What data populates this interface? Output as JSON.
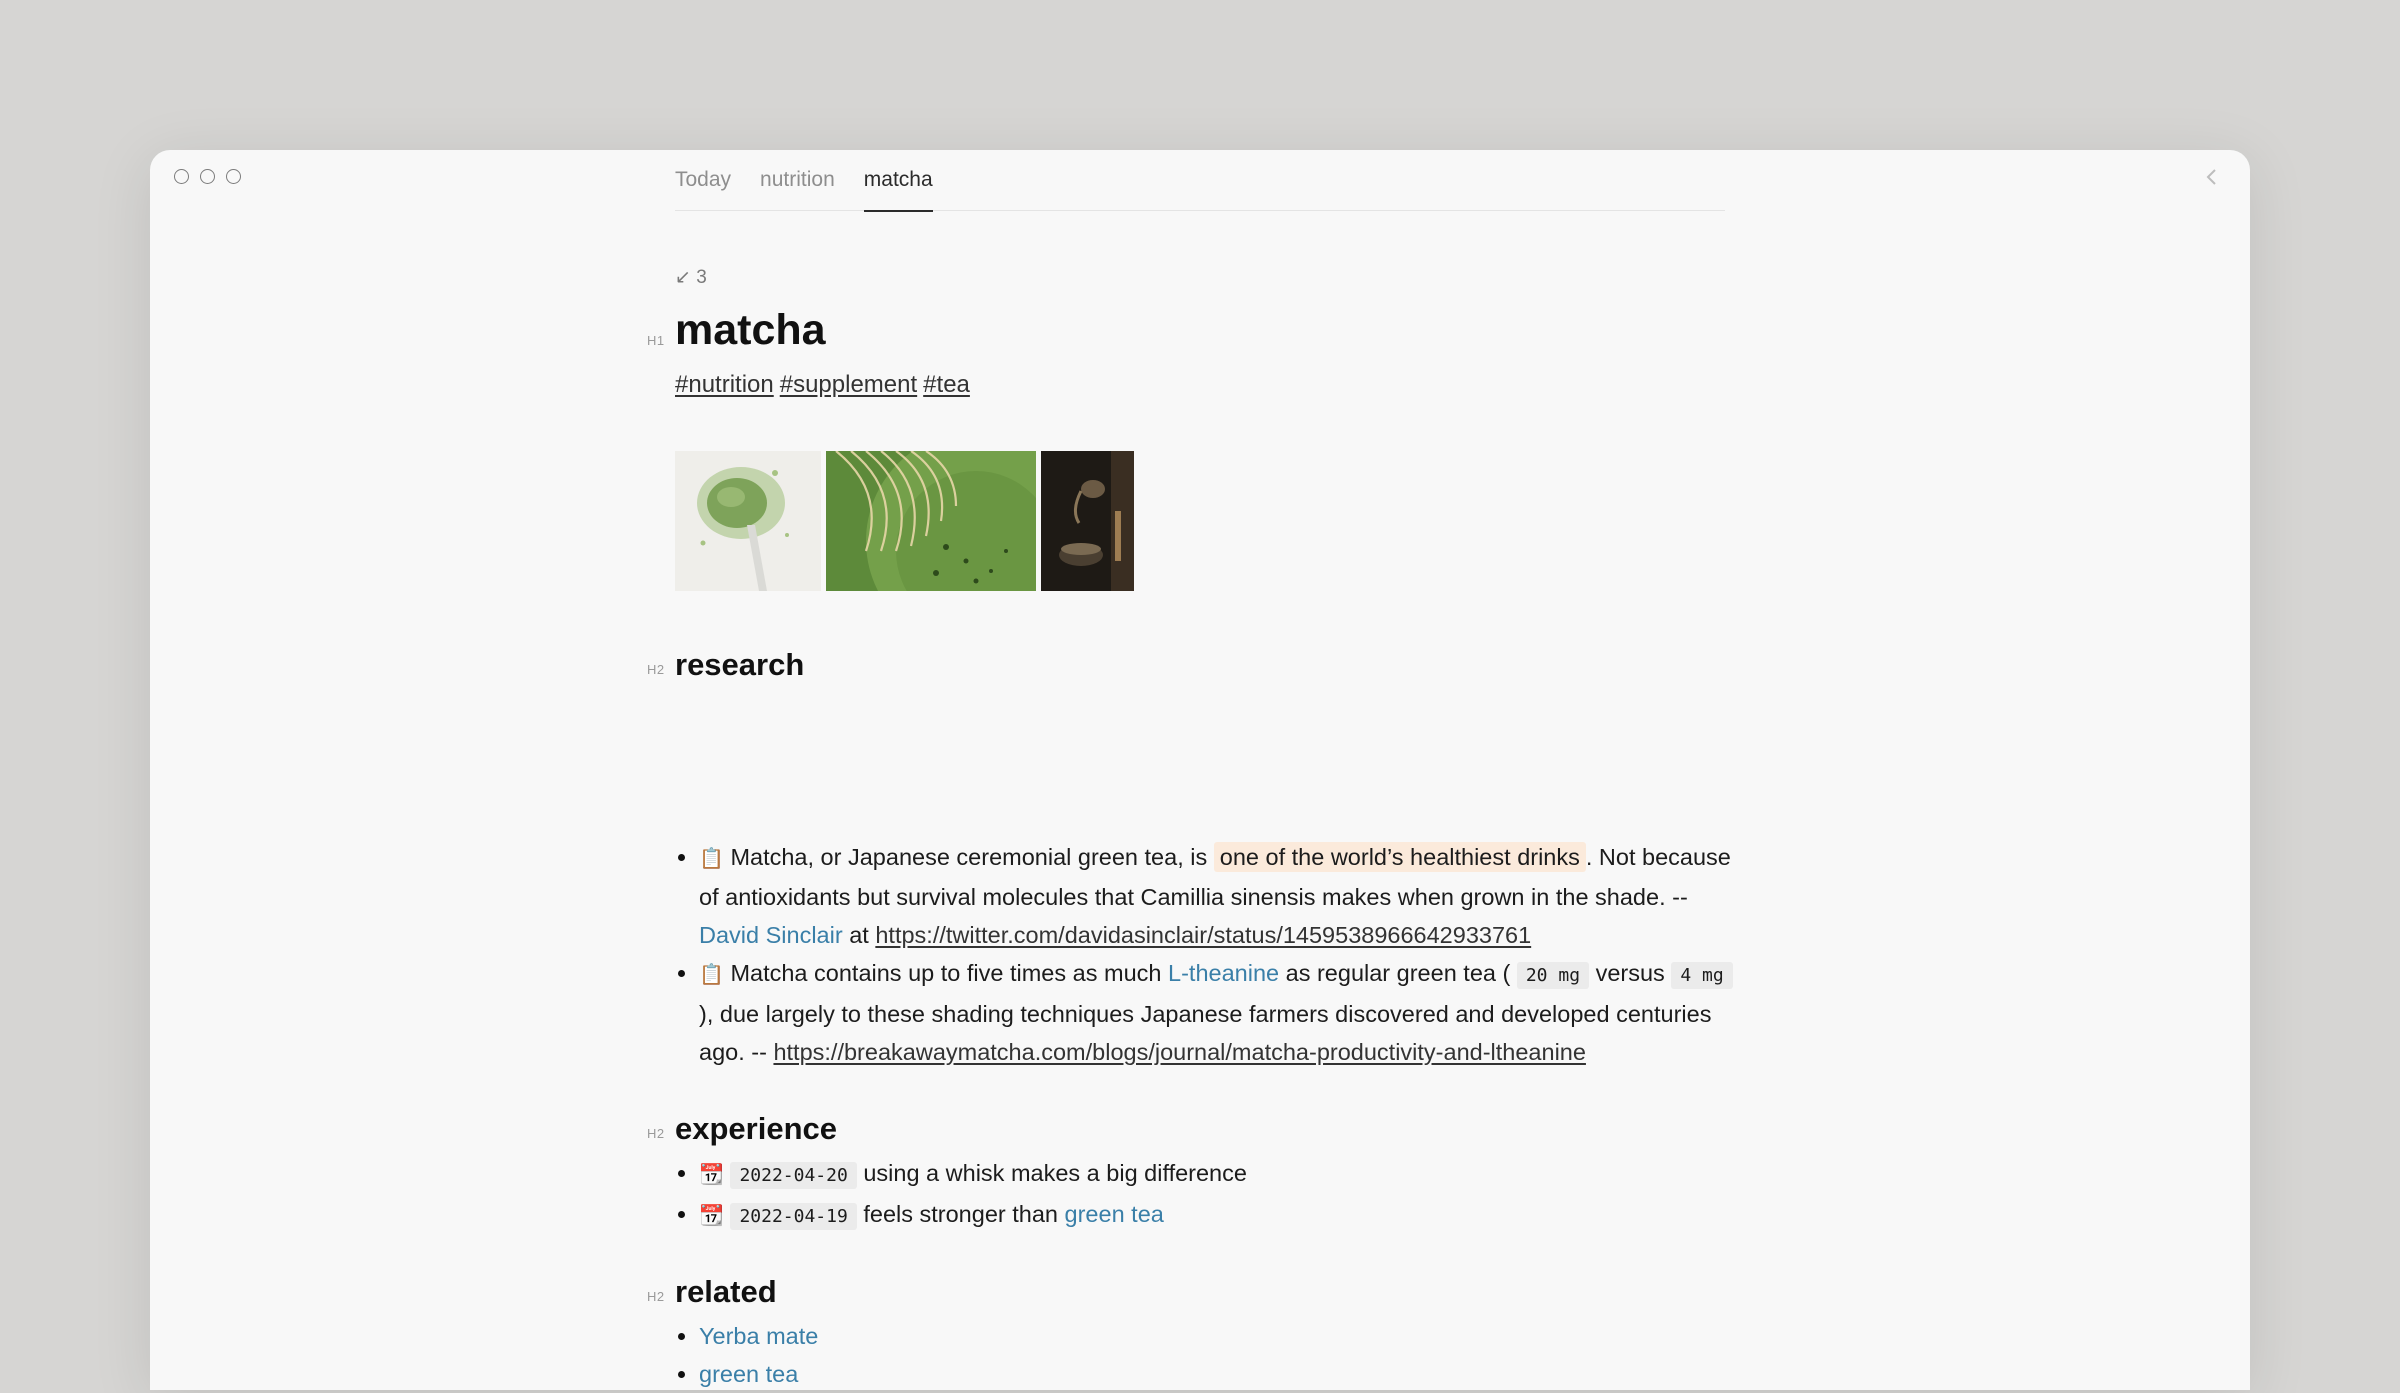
{
  "tabs": [
    "Today",
    "nutrition",
    "matcha"
  ],
  "backlinks": "↙ 3",
  "page_title": "matcha",
  "heading_levels": {
    "h1": "H1",
    "h2": "H2"
  },
  "tags": [
    "#nutrition",
    "#supplement",
    "#tea"
  ],
  "research": {
    "heading": "research",
    "item1": {
      "icon": "📋",
      "t1": "Matcha, or Japanese ceremonial green tea, is",
      "highlight": "one of the world’s healthiest drinks",
      "t2": ". Not because of antioxidants but survival molecules that Camillia sinensis makes when grown in the shade. --",
      "author": "David Sinclair",
      "t3": "at",
      "url": "https://twitter.com/davidasinclair/status/1459538966642933761"
    },
    "item2": {
      "icon": "📋",
      "t1": "Matcha contains up to five times as much",
      "link": "L-theanine",
      "t2": "as regular green tea (",
      "code1": "20 mg",
      "t3": "versus",
      "code2": "4 mg",
      "t4": "), due largely to these shading techniques Japanese farmers discovered and developed centuries ago. --",
      "url": "https://breakawaymatcha.com/blogs/journal/matcha-productivity-and-ltheanine"
    }
  },
  "experience": {
    "heading": "experience",
    "items": [
      {
        "icon": "📆",
        "date": "2022-04-20",
        "text": "using a whisk makes a big difference",
        "link": ""
      },
      {
        "icon": "📆",
        "date": "2022-04-19",
        "text": "feels stronger than",
        "link": "green tea"
      }
    ]
  },
  "related": {
    "heading": "related",
    "items": [
      "Yerba mate",
      "green tea"
    ]
  }
}
